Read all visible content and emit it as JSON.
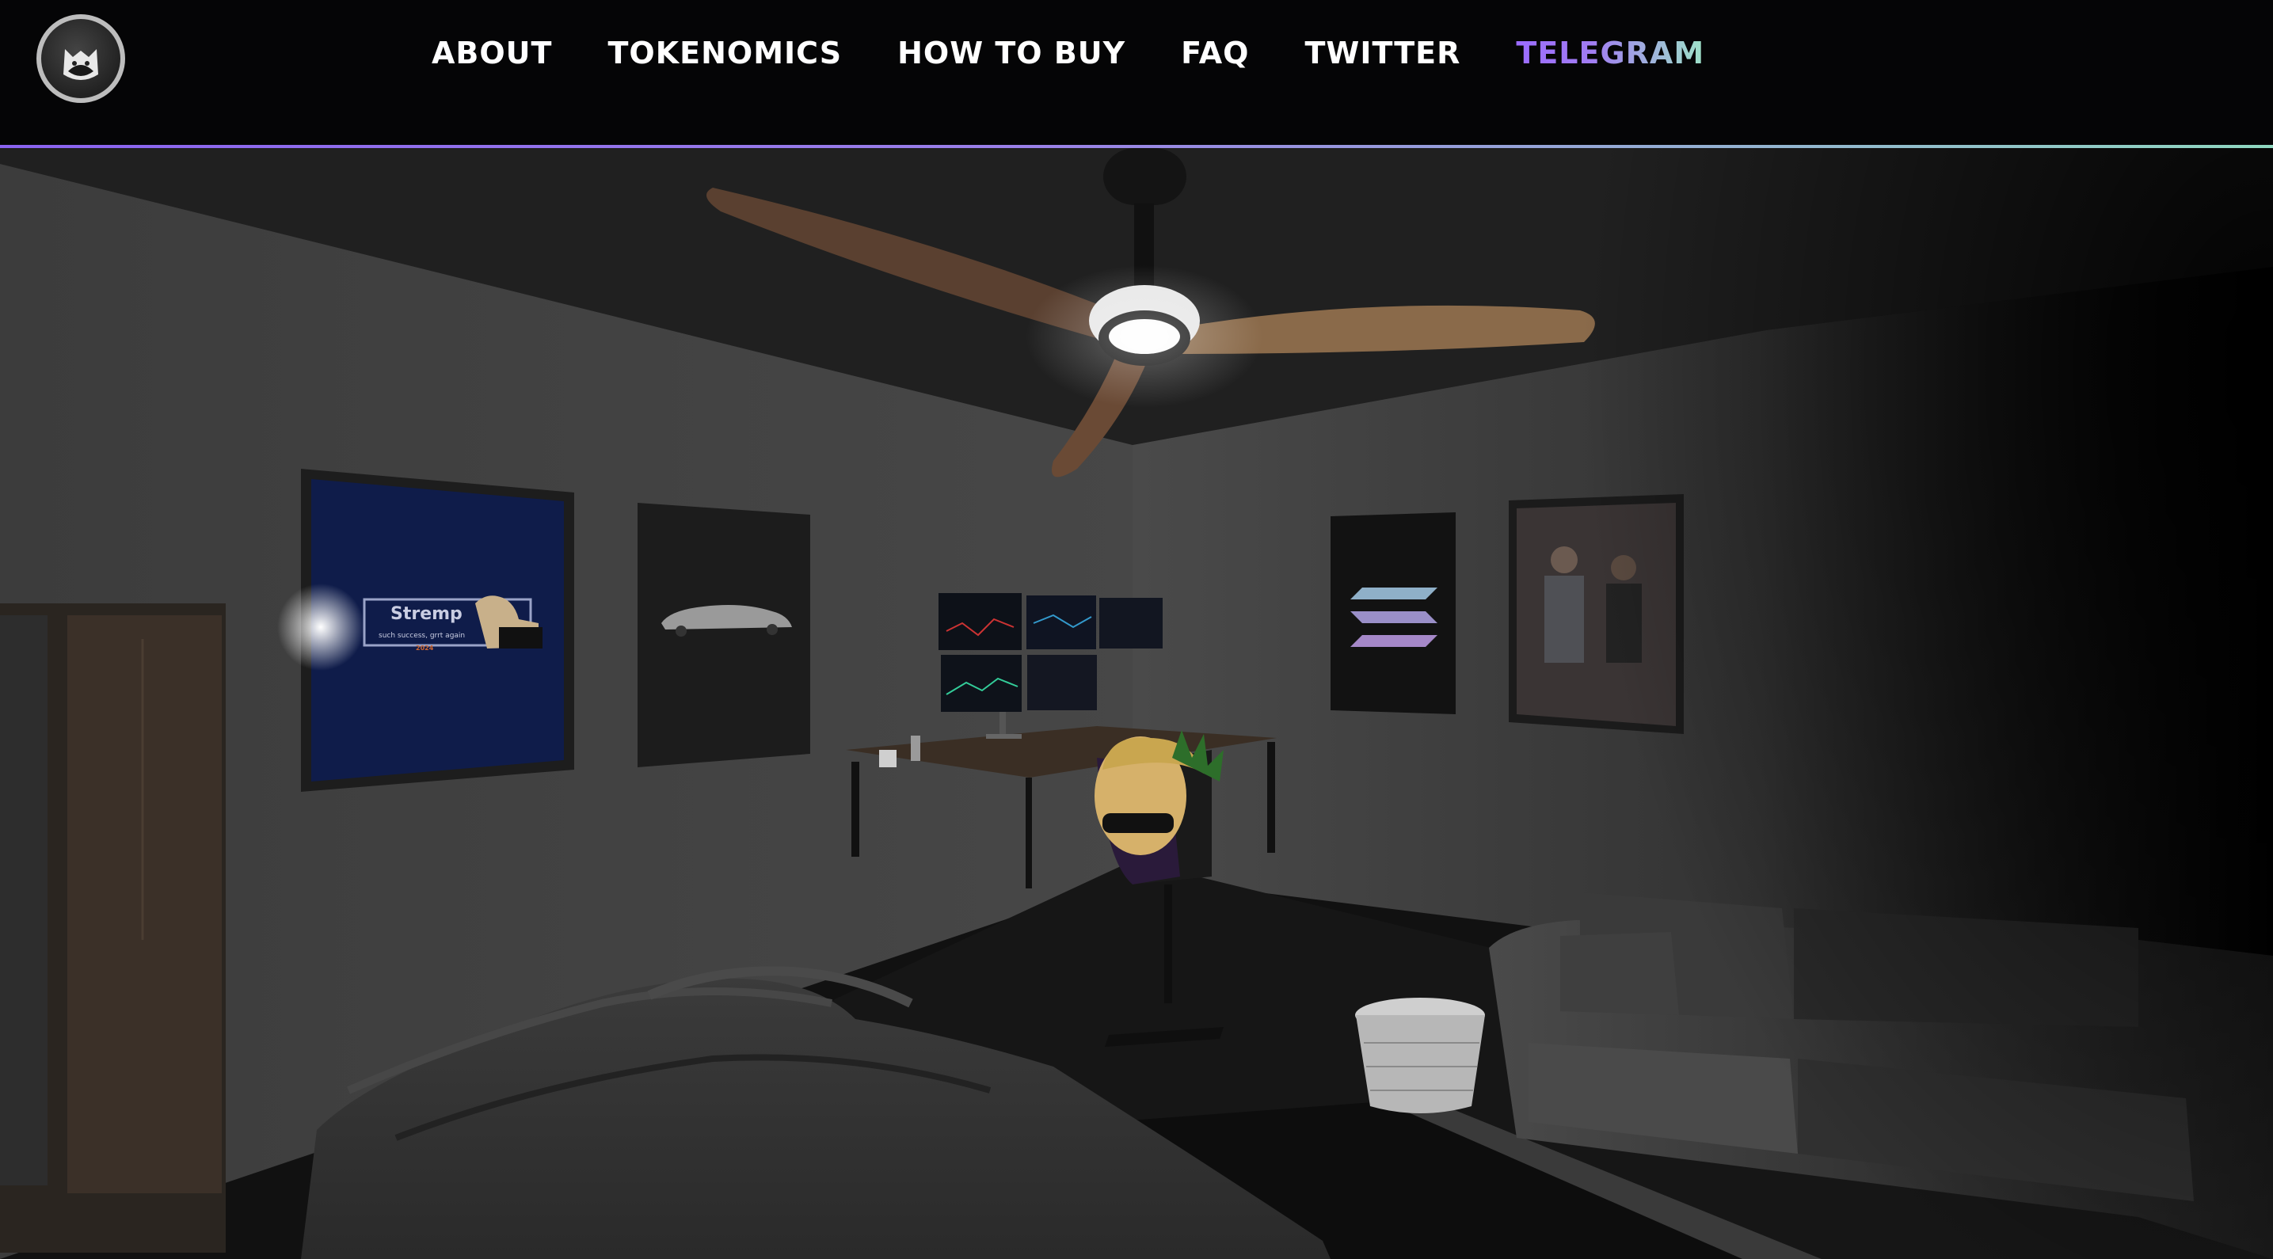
{
  "header": {
    "logo": {
      "icon": "cat-head-icon"
    },
    "nav": [
      {
        "label": "ABOUT",
        "active": false
      },
      {
        "label": "TOKENOMICS",
        "active": false
      },
      {
        "label": "HOW TO BUY",
        "active": false
      },
      {
        "label": "FAQ",
        "active": false
      },
      {
        "label": "TWITTER",
        "active": false
      },
      {
        "label": "TELEGRAM",
        "active": true
      }
    ],
    "colors": {
      "background": "#050506",
      "nav_text": "#ffffff",
      "accent_gradient_start": "#9b6cff",
      "accent_gradient_end": "#9ee3c8"
    }
  },
  "scene": {
    "poster_stremp": {
      "title": "Stremp",
      "subtitle": "such success, grrt again",
      "tag": "2024"
    }
  }
}
